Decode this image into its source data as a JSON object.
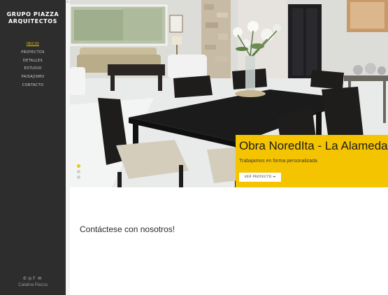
{
  "brand": {
    "line1": "GRUPO PIAZZA",
    "line2": "ARQUITECTOS"
  },
  "nav": [
    {
      "label": "INICIO",
      "active": true
    },
    {
      "label": "PROYECTOS",
      "active": false
    },
    {
      "label": "DETALLES",
      "active": false
    },
    {
      "label": "ESTUDIO",
      "active": false
    },
    {
      "label": "PAISAJISMO",
      "active": false
    },
    {
      "label": "CONTACTO",
      "active": false
    }
  ],
  "social": {
    "icons": [
      "whatsapp-icon",
      "instagram-icon",
      "facebook-icon",
      "mail-icon"
    ],
    "glyphs": [
      "✆",
      "◎",
      "f",
      "✉"
    ]
  },
  "footer": {
    "name": "Catalina Piazza"
  },
  "hero": {
    "caption_title": "Obra NoredIta - La Alameda",
    "caption_subtitle": "Trabajamos en forma personalizada",
    "button_label": "VER PROYECTO ➔",
    "active_slide": 1,
    "slide_count": 3
  },
  "contact": {
    "title": "Contáctese con nosotros!"
  },
  "colors": {
    "accent": "#f5c400",
    "sidebar": "#2d2d2d"
  }
}
